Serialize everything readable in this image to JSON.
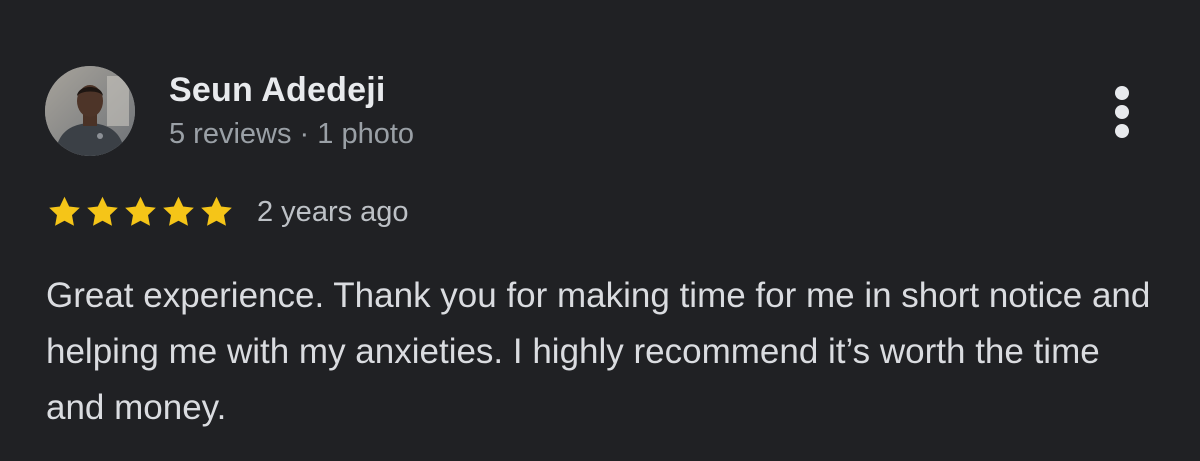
{
  "reviewer": {
    "name": "Seun Adedeji",
    "meta": "5 reviews · 1 photo",
    "avatar_icon": "profile-photo"
  },
  "rating": {
    "stars": 5,
    "max_stars": 5,
    "star_color": "#f5c518",
    "date": "2 years ago"
  },
  "review": {
    "text": "Great experience. Thank you for making time for me in short notice and helping me with my anxieties. I highly recommend it’s worth the time and money."
  },
  "menu": {
    "icon": "more-vertical-icon"
  },
  "colors": {
    "background": "#202124",
    "primary_text": "#e8eaed",
    "secondary_text": "#9aa0a6"
  }
}
